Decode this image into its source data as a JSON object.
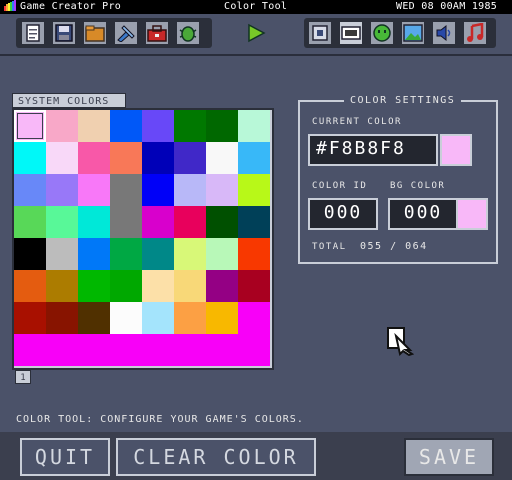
{
  "menubar": {
    "app_title": "Game Creator Pro",
    "tool": "Color Tool",
    "datetime": "WED 08 00AM 1985"
  },
  "toolbar": {
    "left_icons": [
      "document-icon",
      "disk-icon",
      "folder-icon",
      "tools-icon",
      "toolbox-icon",
      "bug-icon"
    ],
    "play_icon": "play-icon",
    "right_icons": [
      "cpu-icon",
      "palette-icon",
      "sprite-icon",
      "image-icon",
      "sound-icon",
      "music-icon"
    ]
  },
  "palette": {
    "tab_label": "SYSTEM COLORS",
    "page": "1",
    "colors": [
      "#F8B8F8",
      "#F8A8C8",
      "#F0D0B0",
      "#0058F8",
      "#6848F8",
      "#007800",
      "#006800",
      "#B8F8D8",
      "#00F8F8",
      "#F8D8F8",
      "#F858A8",
      "#F87858",
      "#0000B8",
      "#4028C8",
      "#F8F8F8",
      "#38B8F8",
      "#6888F8",
      "#9878F8",
      "#F878F8",
      "#787878",
      "#0000F8",
      "#B8B8F8",
      "#D8B8F8",
      "#B8F818",
      "#58D858",
      "#58F898",
      "#00E8D8",
      "#787878",
      "#D800CC",
      "#E8005C",
      "#005000",
      "#004058",
      "#000000",
      "#BCBCBC",
      "#0078F8",
      "#00A844",
      "#008888",
      "#D8F878",
      "#B8F8B8",
      "#F83800",
      "#E45C10",
      "#AC7C00",
      "#00B800",
      "#00A800",
      "#FCE0A8",
      "#F8D878",
      "#940084",
      "#A80020",
      "#A81000",
      "#881400",
      "#503000",
      "#FCFCFC",
      "#A4E4FC",
      "#FCA044",
      "#F8B800",
      "#F800F8",
      "#F800F8",
      "#F800F8",
      "#F800F8",
      "#F800F8",
      "#F800F8",
      "#F800F8",
      "#F800F8",
      "#F800F8"
    ],
    "selected_index": 0
  },
  "settings": {
    "title": "COLOR SETTINGS",
    "current_color_label": "CURRENT COLOR",
    "current_color_value": "#F8B8F8",
    "current_color": "#F8B8F8",
    "color_id_label": "COLOR ID",
    "color_id_value": "000",
    "bg_color_label": "BG COLOR",
    "bg_color_value": "000",
    "bg_color": "#F8B8F8",
    "total_label": "TOTAL",
    "total_value": "055 / 064"
  },
  "status_text": "COLOR TOOL: CONFIGURE YOUR GAME'S COLORS.",
  "buttons": {
    "quit": "QUIT",
    "clear": "CLEAR COLOR",
    "save": "SAVE"
  }
}
